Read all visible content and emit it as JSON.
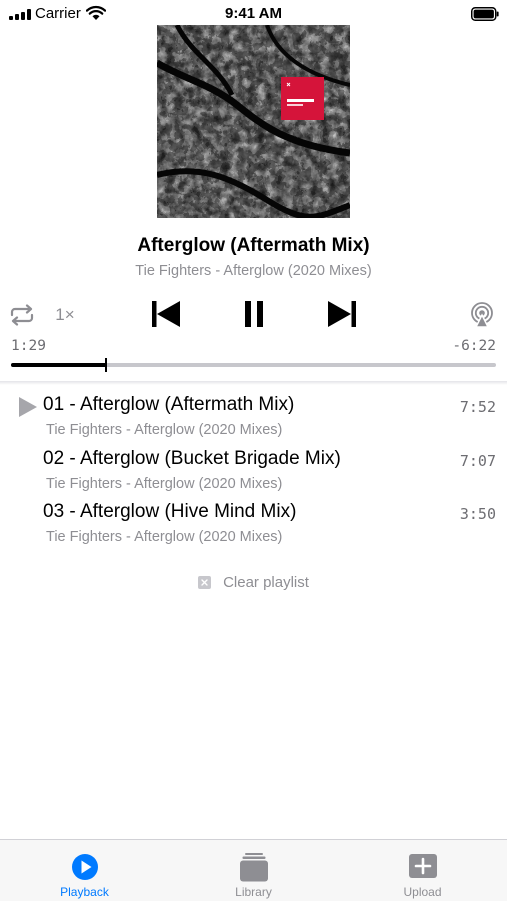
{
  "status_bar": {
    "carrier": "Carrier",
    "time": "9:41 AM"
  },
  "now_playing": {
    "title": "Afterglow (Aftermath Mix)",
    "subtitle": "Tie Fighters - Afterglow (2020 Mixes)",
    "speed": "1×",
    "elapsed": "1:29",
    "remaining": "-6:22",
    "progress": 0.195
  },
  "playlist": {
    "items": [
      {
        "title": "01 - Afterglow (Aftermath Mix)",
        "subtitle": "Tie Fighters - Afterglow (2020 Mixes)",
        "duration": "7:52",
        "playing": true
      },
      {
        "title": "02 - Afterglow (Bucket Brigade Mix)",
        "subtitle": "Tie Fighters - Afterglow (2020 Mixes)",
        "duration": "7:07",
        "playing": false
      },
      {
        "title": "03 - Afterglow (Hive Mind Mix)",
        "subtitle": "Tie Fighters - Afterglow (2020 Mixes)",
        "duration": "3:50",
        "playing": false
      }
    ],
    "clear_label": "Clear playlist"
  },
  "tabs": [
    {
      "label": "Playback",
      "icon": "play-circle-icon",
      "active": true
    },
    {
      "label": "Library",
      "icon": "library-stack-icon",
      "active": false
    },
    {
      "label": "Upload",
      "icon": "upload-plus-icon",
      "active": false
    }
  ],
  "colors": {
    "accent": "#007aff",
    "inactive_tab": "#8e8e93",
    "album_badge": "#d5143a"
  }
}
